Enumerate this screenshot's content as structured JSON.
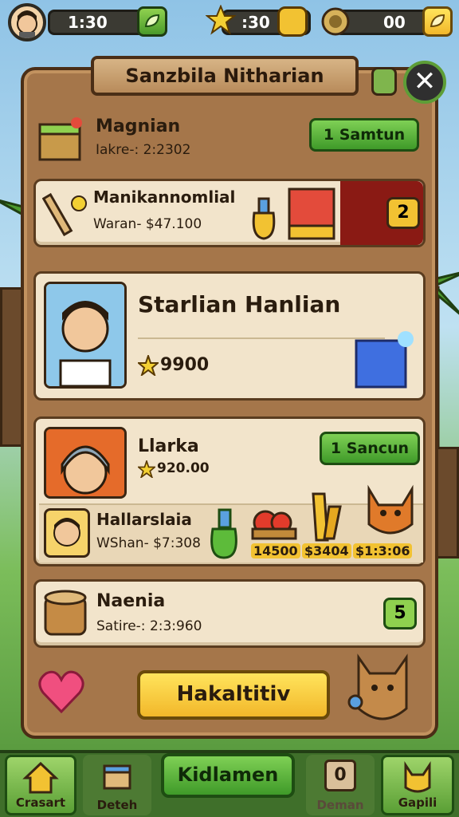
{
  "topbar": {
    "res1": "1:30",
    "res2": ":30",
    "res3": "00"
  },
  "panel": {
    "title": "Sanzbila Nitharian"
  },
  "rows": [
    {
      "title": "Magnian",
      "sub": "Iakre-: 2:2302",
      "button": "1 Samtun"
    },
    {
      "title": "Manikannomlial",
      "sub": "Waran- $47.100",
      "count": "2"
    }
  ],
  "featured": {
    "title": "Starlian Hanlian",
    "value": "9900"
  },
  "group": {
    "item1_title": "Llarka",
    "item1_value": "920.00",
    "item1_button": "1 Sancun",
    "item2_title": "Hallarslaia",
    "item2_sub": "WShan- $7:308",
    "prices": [
      "14500",
      "$3404",
      "$1:3:06"
    ]
  },
  "row5": {
    "title": "Naenia",
    "sub": "Satire-: 2:3:960",
    "count": "5"
  },
  "actions": {
    "primary": "Hakaltitiv"
  },
  "nav": {
    "items": [
      {
        "label": "Crasart"
      },
      {
        "label": "Deteh"
      },
      {
        "label": "Kidlamen"
      },
      {
        "label": "Deman"
      },
      {
        "label": "Gapili"
      }
    ],
    "deman_count": "0"
  }
}
